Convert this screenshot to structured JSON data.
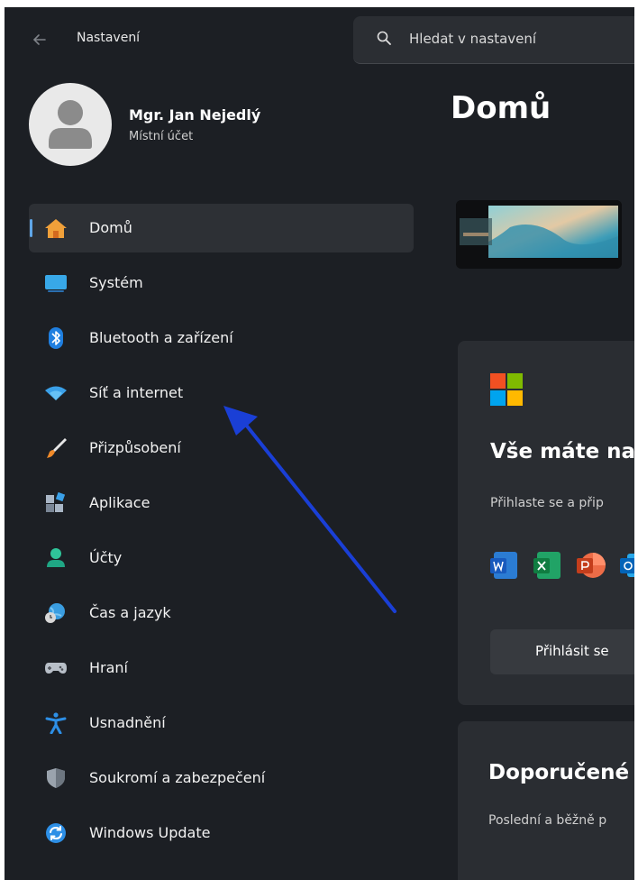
{
  "window": {
    "app_title": "Nastavení",
    "back_icon": "back-arrow-icon"
  },
  "search": {
    "placeholder": "Hledat v nastavení",
    "icon": "search-icon"
  },
  "profile": {
    "name": "Mgr. Jan Nejedlý",
    "account_type": "Místní účet"
  },
  "sidebar": {
    "items": [
      {
        "label": "Domů",
        "icon": "home-icon",
        "active": true
      },
      {
        "label": "Systém",
        "icon": "system-display-icon"
      },
      {
        "label": "Bluetooth a zařízení",
        "icon": "bluetooth-icon"
      },
      {
        "label": "Síť a internet",
        "icon": "wifi-icon"
      },
      {
        "label": "Přizpůsobení",
        "icon": "paintbrush-icon"
      },
      {
        "label": "Aplikace",
        "icon": "apps-icon"
      },
      {
        "label": "Účty",
        "icon": "person-icon"
      },
      {
        "label": "Čas a jazyk",
        "icon": "globe-clock-icon"
      },
      {
        "label": "Hraní",
        "icon": "gamepad-icon"
      },
      {
        "label": "Usnadnění",
        "icon": "accessibility-icon"
      },
      {
        "label": "Soukromí a zabezpečení",
        "icon": "shield-icon"
      },
      {
        "label": "Windows Update",
        "icon": "update-sync-icon"
      }
    ]
  },
  "main": {
    "title": "Domů",
    "card_m365": {
      "title": "Vše máte na",
      "text": "Přihlaste se a přip",
      "signin_label": "Přihlásit se",
      "app_icons": [
        "word-icon",
        "excel-icon",
        "powerpoint-icon",
        "outlook-icon"
      ]
    },
    "card_recommended": {
      "title": "Doporučené",
      "text": "Poslední a běžně p"
    }
  },
  "colors": {
    "background": "#1c1f24",
    "card": "#2a2d32",
    "accent": "#5fa6e8",
    "annotation_arrow": "#1a3fd6"
  }
}
